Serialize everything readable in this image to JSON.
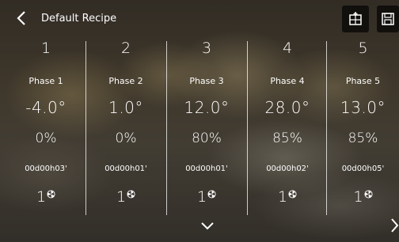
{
  "header": {
    "title": "Default Recipe",
    "back_icon": "chevron-left-icon",
    "buttons": [
      {
        "icon": "add-table-icon"
      },
      {
        "icon": "save-icon"
      }
    ]
  },
  "phases": [
    {
      "number": "1",
      "name": "Phase 1",
      "temperature": "-4.0°",
      "humidity": "0%",
      "duration": "00d00h03'",
      "fan": "1"
    },
    {
      "number": "2",
      "name": "Phase 2",
      "temperature": "1.0°",
      "humidity": "0%",
      "duration": "00d00h01'",
      "fan": "1"
    },
    {
      "number": "3",
      "name": "Phase 3",
      "temperature": "12.0°",
      "humidity": "80%",
      "duration": "00d00h01'",
      "fan": "1"
    },
    {
      "number": "4",
      "name": "Phase 4",
      "temperature": "28.0°",
      "humidity": "85%",
      "duration": "00d00h02'",
      "fan": "1"
    },
    {
      "number": "5",
      "name": "Phase 5",
      "temperature": "13.0°",
      "humidity": "85%",
      "duration": "00d00h05'",
      "fan": "1"
    }
  ],
  "nav": {
    "down_icon": "chevron-down-icon",
    "right_icon": "chevron-right-icon"
  }
}
